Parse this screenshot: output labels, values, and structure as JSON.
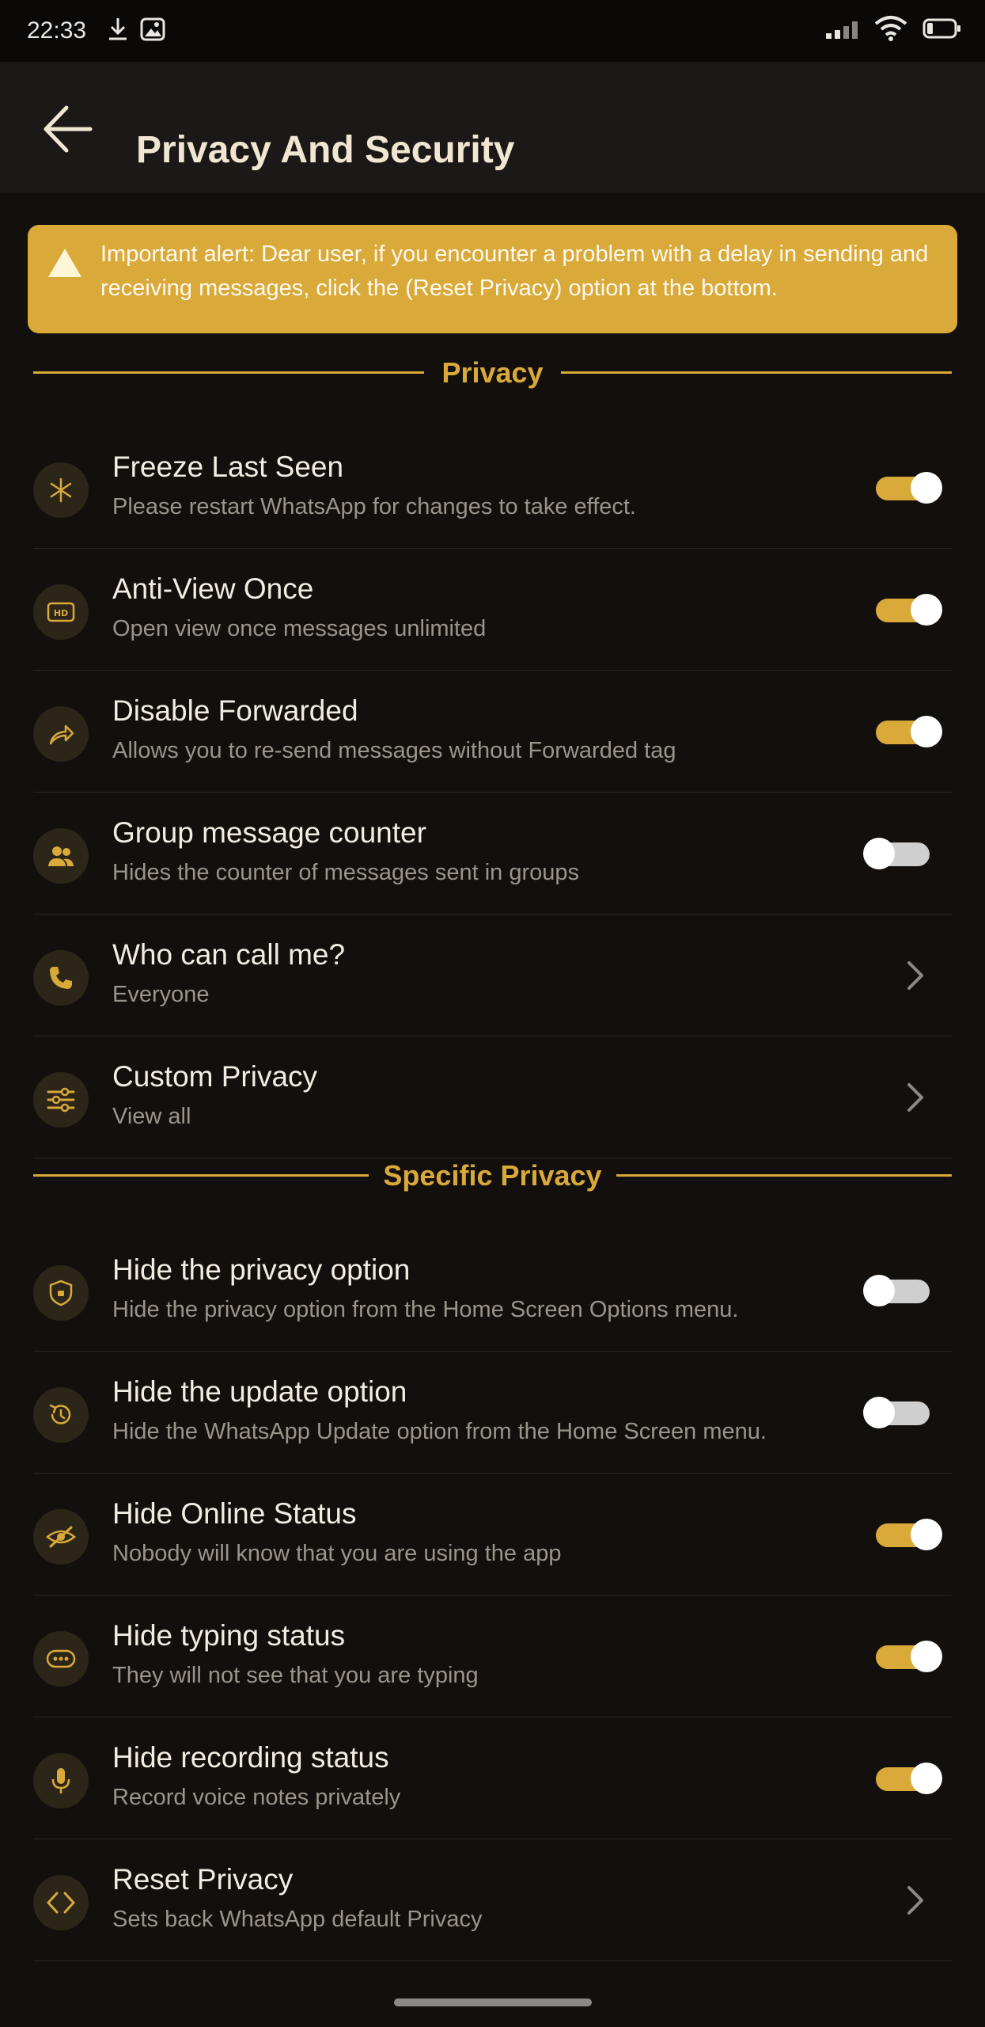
{
  "status_bar": {
    "time": "22:33"
  },
  "app_bar": {
    "title": "Privacy And Security"
  },
  "alert": {
    "text": "Important alert: Dear user, if you encounter a problem with a delay in sending and receiving messages, click the (Reset Privacy) option at the bottom."
  },
  "sections": {
    "privacy": "Privacy",
    "specific": "Specific Privacy"
  },
  "colors": {
    "accent": "#d9a93a",
    "background": "#130f0d",
    "toggle_off": "#cfcfcf"
  },
  "privacy_items": [
    {
      "title": "Freeze Last Seen",
      "subtitle": "Please restart WhatsApp for changes to take effect.",
      "icon": "snowflake-icon",
      "control": "toggle",
      "on": true
    },
    {
      "title": "Anti-View Once",
      "subtitle": "Open view once messages unlimited",
      "icon": "hd-icon",
      "control": "toggle",
      "on": true
    },
    {
      "title": "Disable Forwarded",
      "subtitle": "Allows you to re-send messages without Forwarded tag",
      "icon": "forward-icon",
      "control": "toggle",
      "on": true
    },
    {
      "title": "Group message counter",
      "subtitle": "Hides the counter of messages sent in groups",
      "icon": "group-icon",
      "control": "toggle",
      "on": false
    },
    {
      "title": "Who can call me?",
      "subtitle": "Everyone",
      "icon": "phone-icon",
      "control": "chevron"
    },
    {
      "title": "Custom Privacy",
      "subtitle": "View all",
      "icon": "sliders-icon",
      "control": "chevron"
    }
  ],
  "specific_items": [
    {
      "title": "Hide the privacy option",
      "subtitle": "Hide the privacy option from the Home Screen Options menu.",
      "icon": "shield-icon",
      "control": "toggle",
      "on": false
    },
    {
      "title": "Hide the update option",
      "subtitle": "Hide the WhatsApp Update option from the Home Screen menu.",
      "icon": "restore-icon",
      "control": "toggle",
      "on": false
    },
    {
      "title": "Hide Online Status",
      "subtitle": "Nobody will know that you are using the app",
      "icon": "eye-off-icon",
      "control": "toggle",
      "on": true
    },
    {
      "title": "Hide typing status",
      "subtitle": "They will not see that you are typing",
      "icon": "typing-icon",
      "control": "toggle",
      "on": true
    },
    {
      "title": "Hide recording status",
      "subtitle": "Record voice notes privately",
      "icon": "mic-icon",
      "control": "toggle",
      "on": true
    },
    {
      "title": "Reset Privacy",
      "subtitle": "Sets back WhatsApp default Privacy",
      "icon": "code-icon",
      "control": "chevron"
    }
  ]
}
